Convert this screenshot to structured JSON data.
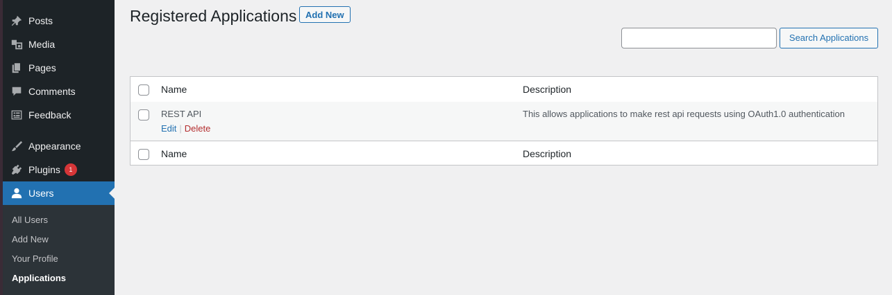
{
  "sidebar": {
    "items": [
      {
        "label": "Posts",
        "icon": "pin-icon"
      },
      {
        "label": "Media",
        "icon": "media-icon"
      },
      {
        "label": "Pages",
        "icon": "pages-icon"
      },
      {
        "label": "Comments",
        "icon": "comment-icon"
      },
      {
        "label": "Feedback",
        "icon": "feedback-icon"
      },
      {
        "label": "Appearance",
        "icon": "brush-icon"
      },
      {
        "label": "Plugins",
        "icon": "plugin-icon",
        "badge": "1"
      },
      {
        "label": "Users",
        "icon": "user-icon",
        "current": true
      }
    ],
    "submenu": [
      {
        "label": "All Users"
      },
      {
        "label": "Add New"
      },
      {
        "label": "Your Profile"
      },
      {
        "label": "Applications",
        "current": true
      }
    ]
  },
  "page": {
    "title": "Registered Applications",
    "add_new_label": "Add New"
  },
  "search": {
    "value": "",
    "button_label": "Search Applications"
  },
  "table": {
    "columns": [
      "Name",
      "Description"
    ],
    "rows": [
      {
        "name": "REST API",
        "description": "This allows applications to make rest api requests using OAuth1.0 authentication",
        "actions": {
          "edit": "Edit",
          "separator": "|",
          "delete": "Delete"
        }
      }
    ]
  },
  "colors": {
    "sidebar_bg": "#1d2327",
    "accent": "#2271b1",
    "badge": "#d63638",
    "delete": "#b32d2e"
  }
}
